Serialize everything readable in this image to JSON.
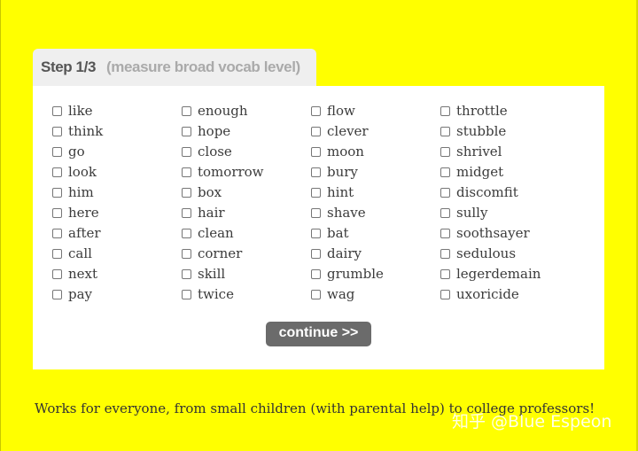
{
  "colors": {
    "background": "#ffff00",
    "panel": "#ffffff",
    "tab": "#efefef",
    "button": "#6b6b6b"
  },
  "tab": {
    "step": "Step 1/3",
    "subtitle": "(measure broad vocab level)"
  },
  "words": [
    [
      "like",
      "think",
      "go",
      "look",
      "him",
      "here",
      "after",
      "call",
      "next",
      "pay"
    ],
    [
      "enough",
      "hope",
      "close",
      "tomorrow",
      "box",
      "hair",
      "clean",
      "corner",
      "skill",
      "twice"
    ],
    [
      "flow",
      "clever",
      "moon",
      "bury",
      "hint",
      "shave",
      "bat",
      "dairy",
      "grumble",
      "wag"
    ],
    [
      "throttle",
      "stubble",
      "shrivel",
      "midget",
      "discomfit",
      "sully",
      "soothsayer",
      "sedulous",
      "legerdemain",
      "uxoricide"
    ]
  ],
  "continue_label": "continue >>",
  "footer_text": "Works for everyone, from small children (with parental help) to college professors!",
  "watermark": "知乎 @Blue Espeon"
}
